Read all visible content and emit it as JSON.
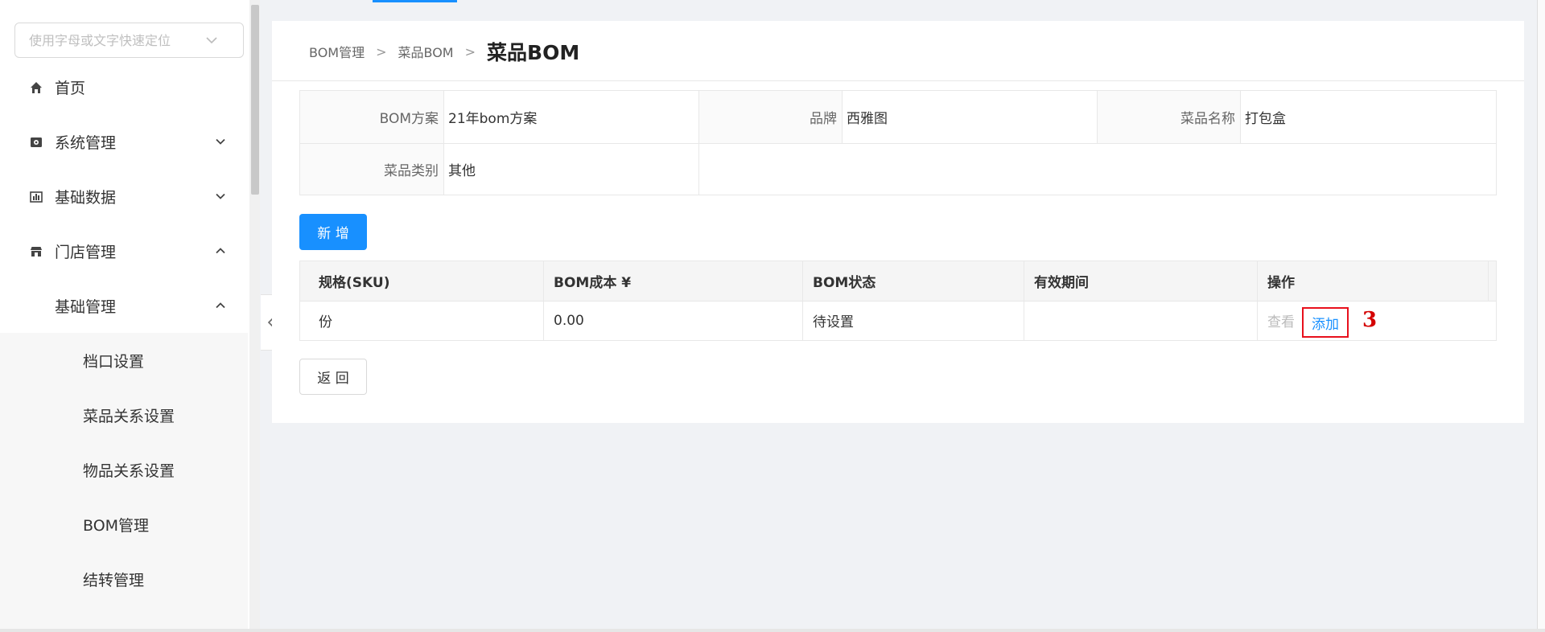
{
  "sidebar": {
    "search": {
      "placeholder": "使用字母或文字快速定位"
    },
    "items": [
      {
        "label": "首页"
      },
      {
        "label": "系统管理"
      },
      {
        "label": "基础数据"
      },
      {
        "label": "门店管理"
      },
      {
        "label": "基础管理"
      }
    ],
    "subitems": [
      {
        "label": "档口设置"
      },
      {
        "label": "菜品关系设置"
      },
      {
        "label": "物品关系设置"
      },
      {
        "label": "BOM管理"
      },
      {
        "label": "结转管理"
      }
    ]
  },
  "breadcrumb": {
    "items": [
      "BOM管理",
      "菜品BOM"
    ],
    "separator": ">",
    "current": "菜品BOM"
  },
  "info": {
    "plan_label": "BOM方案",
    "plan_value": "21年bom方案",
    "brand_label": "品牌",
    "brand_value": "西雅图",
    "dish_name_label": "菜品名称",
    "dish_name_value": "打包盒",
    "category_label": "菜品类别",
    "category_value": "其他"
  },
  "toolbar": {
    "add_label": "新 增"
  },
  "table": {
    "columns": [
      "规格(SKU)",
      "BOM成本 ¥",
      "BOM状态",
      "有效期间",
      "操作"
    ],
    "rows": [
      {
        "sku": "份",
        "cost": "0.00",
        "status": "待设置",
        "period": "",
        "view_label": "查看",
        "add_label": "添加"
      }
    ]
  },
  "annotation": {
    "number": "3"
  },
  "footer": {
    "back_label": "返 回"
  },
  "colors": {
    "primary": "#1890ff",
    "annotation": "#e8101c"
  }
}
